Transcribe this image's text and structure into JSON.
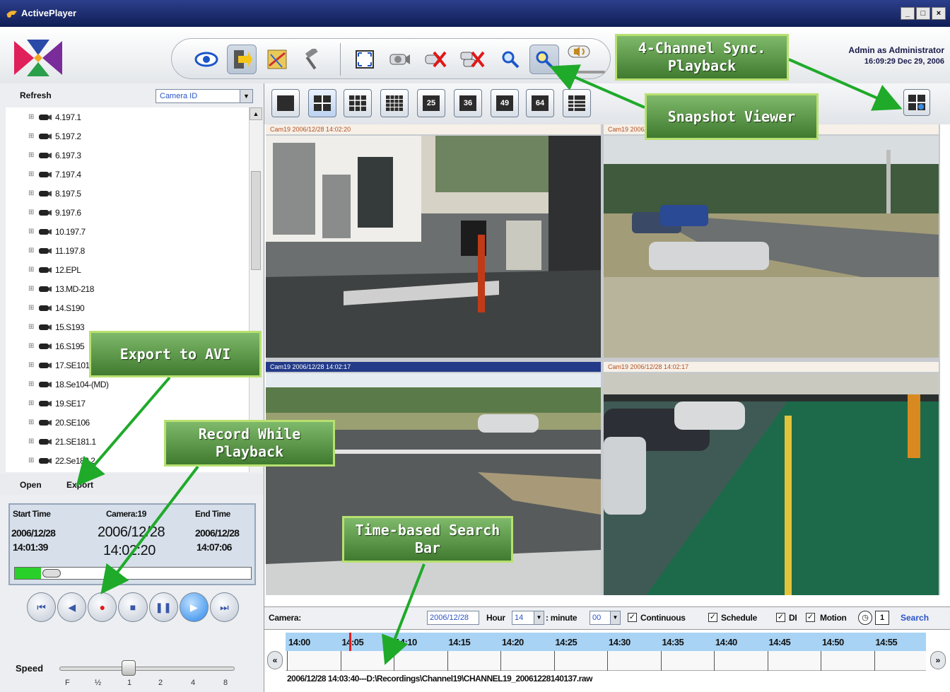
{
  "window": {
    "title": "ActivePlayer",
    "controls": [
      "_",
      "□",
      "×"
    ]
  },
  "toolbar": {
    "buttons": [
      "eye-icon",
      "import-icon",
      "map-icon",
      "tools-icon",
      "fullscreen-icon",
      "camera-icon",
      "disconnect-icon",
      "disconnect-all-icon",
      "search-icon",
      "snapshot-search-icon",
      "audio-icon"
    ]
  },
  "user": {
    "line1": "Admin as Administrator",
    "line2": "16:09:29 Dec 29, 2006"
  },
  "sidebar": {
    "refresh": "Refresh",
    "camera_select": "Camera ID",
    "tree": [
      "4.197.1",
      "5.197.2",
      "6.197.3",
      "7.197.4",
      "8.197.5",
      "9.197.6",
      "10.197.7",
      "11.197.8",
      "12.EPL",
      "13.MD-218",
      "14.S190",
      "15.S193",
      "16.S195",
      "17.SE101",
      "18.Se104-(MD)",
      "19.SE17",
      "20.SE106",
      "21.SE181.1",
      "22.Se182.2"
    ],
    "open": "Open",
    "export": "Export"
  },
  "playback": {
    "start_label": "Start Time",
    "camera_label": "Camera:19",
    "end_label": "End Time",
    "start_date": "2006/12/28",
    "start_time": "14:01:39",
    "current_date": "2006/12/28",
    "current_time": "14:02:20",
    "end_date": "2006/12/28",
    "end_time": "14:07:06",
    "progress": 0.11,
    "speed_label": "Speed",
    "speed_ticks": [
      "F",
      "½",
      "1",
      "2",
      "4",
      "8"
    ]
  },
  "layouts": [
    "1",
    "4",
    "9",
    "16",
    "25",
    "36",
    "49",
    "64",
    "custom"
  ],
  "cameras": [
    {
      "caption": "Cam19 2006/12/28 14:02:20",
      "selected": false
    },
    {
      "caption": "Cam19 2006/12/28 14:02:19",
      "selected": false
    },
    {
      "caption": "Cam19 2006/12/28 14:02:17",
      "selected": true
    },
    {
      "caption": "Cam19 2006/12/28 14:02:17",
      "selected": false
    }
  ],
  "search": {
    "camera_label": "Camera:",
    "date": "2006/12/28",
    "hour_label": "Hour",
    "hour": "14",
    "minute_label": ": minute",
    "minute": "00",
    "continuous": "Continuous",
    "schedule": "Schedule",
    "di": "DI",
    "motion": "Motion",
    "page": "1",
    "search_btn": "Search"
  },
  "timeline": {
    "hours": [
      "14:00",
      "14:05",
      "14:10",
      "14:15",
      "14:20",
      "14:25",
      "14:30",
      "14:35",
      "14:40",
      "14:45",
      "14:50",
      "14:55"
    ],
    "path": "2006/12/28 14:03:40---D:\\Recordings\\Channel19\\CHANNEL19_20061228140137.raw",
    "left": "«",
    "right": "»"
  },
  "callouts": {
    "sync": "4-Channel Sync. Playback",
    "snapshot": "Snapshot Viewer",
    "export_avi": "Export to AVI",
    "record": "Record While Playback",
    "timebar": "Time-based Search Bar"
  },
  "colors": {
    "title_bar": "#1c2a6c",
    "callout_green": "#4e8a3c",
    "timeline_blue": "#a8d3f4"
  }
}
